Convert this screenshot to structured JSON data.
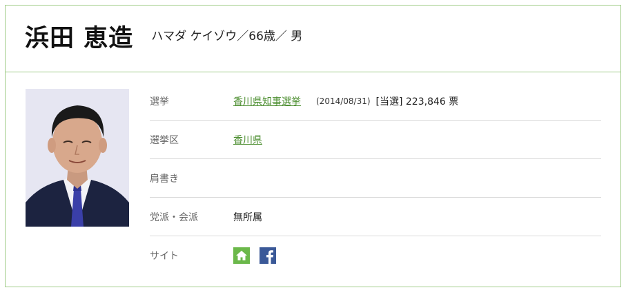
{
  "profile": {
    "name": "浜田 恵造",
    "reading": "ハマダ ケイゾウ／66歳／ 男"
  },
  "details": {
    "election_label": "選挙",
    "election_link": "香川県知事選挙",
    "election_date": "(2014/08/31)",
    "election_result": "[当選] 223,846 票",
    "district_label": "選挙区",
    "district_link": "香川県",
    "title_label": "肩書き",
    "title_value": "",
    "party_label": "党派・会派",
    "party_value": "無所属",
    "site_label": "サイト"
  },
  "icons": {
    "home": "home-icon",
    "facebook": "facebook-icon"
  },
  "colors": {
    "border": "#9fcc86",
    "link": "#4e8f32",
    "home_icon_bg": "#6bb84a",
    "facebook_bg": "#3b5998"
  }
}
